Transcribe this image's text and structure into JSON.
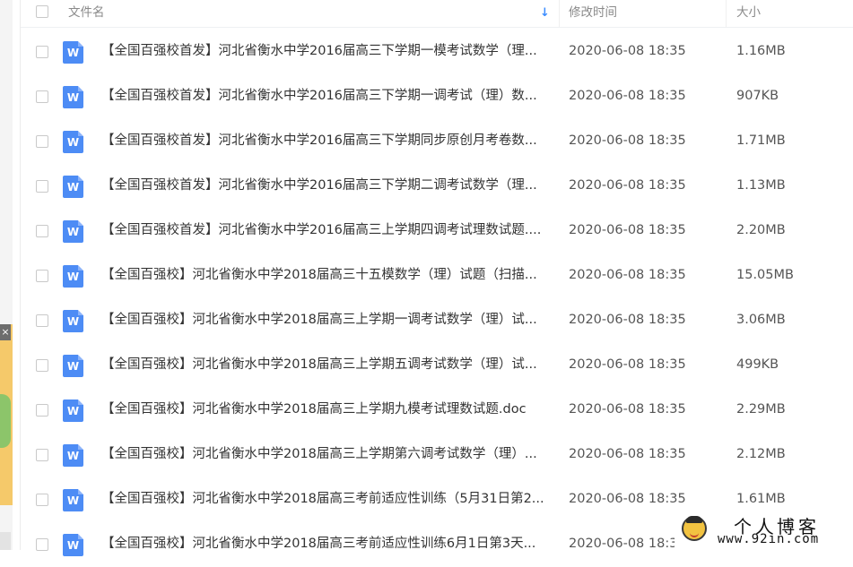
{
  "header": {
    "name_label": "文件名",
    "sort_icon": "arrow-down-icon",
    "modified_label": "修改时间",
    "size_label": "大小"
  },
  "side_ad": {
    "close_label": "×"
  },
  "files": [
    {
      "icon": "W",
      "name": "【全国百强校首发】河北省衡水中学2016届高三下学期一模考试数学（理...",
      "modified": "2020-06-08 18:35",
      "size": "1.16MB"
    },
    {
      "icon": "W",
      "name": "【全国百强校首发】河北省衡水中学2016届高三下学期一调考试（理）数...",
      "modified": "2020-06-08 18:35",
      "size": "907KB"
    },
    {
      "icon": "W",
      "name": "【全国百强校首发】河北省衡水中学2016届高三下学期同步原创月考卷数...",
      "modified": "2020-06-08 18:35",
      "size": "1.71MB"
    },
    {
      "icon": "W",
      "name": "【全国百强校首发】河北省衡水中学2016届高三下学期二调考试数学（理...",
      "modified": "2020-06-08 18:35",
      "size": "1.13MB"
    },
    {
      "icon": "W",
      "name": "【全国百强校首发】河北省衡水中学2016届高三上学期四调考试理数试题....",
      "modified": "2020-06-08 18:35",
      "size": "2.20MB"
    },
    {
      "icon": "W",
      "name": "【全国百强校】河北省衡水中学2018届高三十五模数学（理）试题（扫描...",
      "modified": "2020-06-08 18:35",
      "size": "15.05MB"
    },
    {
      "icon": "W",
      "name": "【全国百强校】河北省衡水中学2018届高三上学期一调考试数学（理）试...",
      "modified": "2020-06-08 18:35",
      "size": "3.06MB"
    },
    {
      "icon": "W",
      "name": "【全国百强校】河北省衡水中学2018届高三上学期五调考试数学（理）试...",
      "modified": "2020-06-08 18:35",
      "size": "499KB"
    },
    {
      "icon": "W",
      "name": "【全国百强校】河北省衡水中学2018届高三上学期九模考试理数试题.doc",
      "modified": "2020-06-08 18:35",
      "size": "2.29MB"
    },
    {
      "icon": "W",
      "name": "【全国百强校】河北省衡水中学2018届高三上学期第六调考试数学（理）...",
      "modified": "2020-06-08 18:35",
      "size": "2.12MB"
    },
    {
      "icon": "W",
      "name": "【全国百强校】河北省衡水中学2018届高三考前适应性训练（5月31日第2...",
      "modified": "2020-06-08 18:35",
      "size": "1.61MB"
    },
    {
      "icon": "W",
      "name": "【全国百强校】河北省衡水中学2018届高三考前适应性训练6月1日第3天...",
      "modified": "2020-06-08 18:35",
      "size": ""
    }
  ],
  "watermark": {
    "title": "个人博客",
    "url": "www.92in.com"
  }
}
